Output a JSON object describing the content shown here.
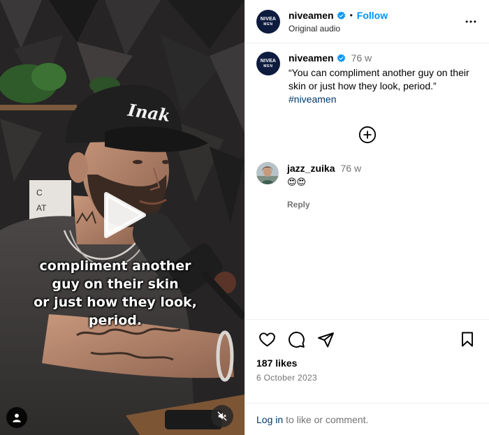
{
  "post": {
    "username": "niveamen",
    "avatar_text_top": "NIVEA",
    "avatar_text_bottom": "MEN",
    "follow_label": "Follow",
    "separator": "•",
    "audio_label": "Original audio",
    "caption_time": "76 w",
    "caption_text": "“You can compliment another guy on their skin or just how they look, period.”",
    "hashtag": "#niveamen",
    "likes": "187 likes",
    "date": "6 October 2023"
  },
  "video": {
    "subtitle_lines": [
      "compliment another",
      "guy on their skin",
      "or just how they look,",
      "period."
    ],
    "cap_text": "Inak"
  },
  "comment": {
    "username": "jazz_zuika",
    "time": "76 w",
    "text": "😍😍",
    "reply_label": "Reply"
  },
  "footer": {
    "login_label": "Log in",
    "rest_text": "to like or comment."
  },
  "icons": {
    "header_more": "more-horizontal-icon",
    "verified": "verified-badge-icon",
    "load_more": "plus-circle-icon",
    "like": "heart-icon",
    "comment": "comment-icon",
    "share": "send-icon",
    "save": "bookmark-icon",
    "play": "play-icon",
    "user_tag": "user-icon",
    "mute": "muted-speaker-icon"
  },
  "colors": {
    "accent": "#0095f6",
    "link": "#00376b",
    "verified": "#0095f6",
    "muted_text": "#737373",
    "nivea_blue": "#0d1b3e"
  }
}
